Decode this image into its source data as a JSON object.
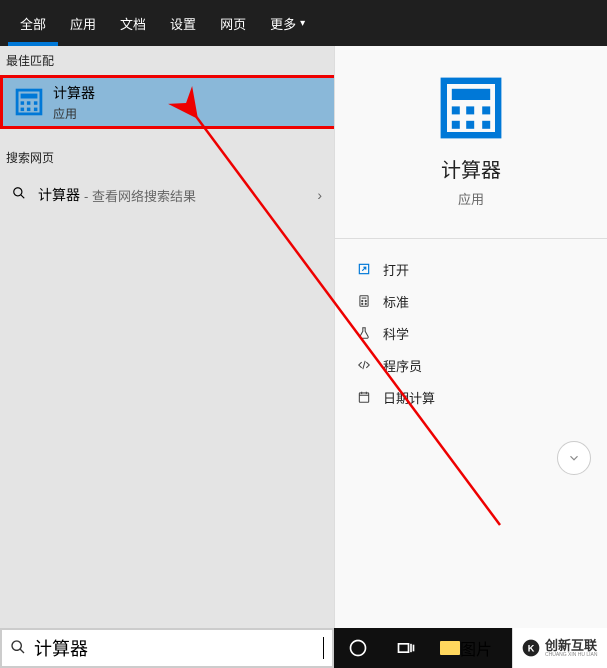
{
  "tabs": {
    "all": "全部",
    "apps": "应用",
    "docs": "文档",
    "settings": "设置",
    "web": "网页",
    "more": "更多"
  },
  "left": {
    "best_match_label": "最佳匹配",
    "best": {
      "title": "计算器",
      "subtitle": "应用"
    },
    "search_web_label": "搜索网页",
    "web_row": {
      "query": "计算器",
      "hint": "- 查看网络搜索结果"
    }
  },
  "right": {
    "title": "计算器",
    "subtitle": "应用",
    "actions": {
      "open": "打开",
      "standard": "标准",
      "scientific": "科学",
      "programmer": "程序员",
      "date": "日期计算"
    }
  },
  "search": {
    "value": "计算器"
  },
  "taskbar": {
    "pictures": "图片"
  },
  "watermark": {
    "brand": "创新互联",
    "sub": "CHUANG XIN HU LIAN"
  }
}
